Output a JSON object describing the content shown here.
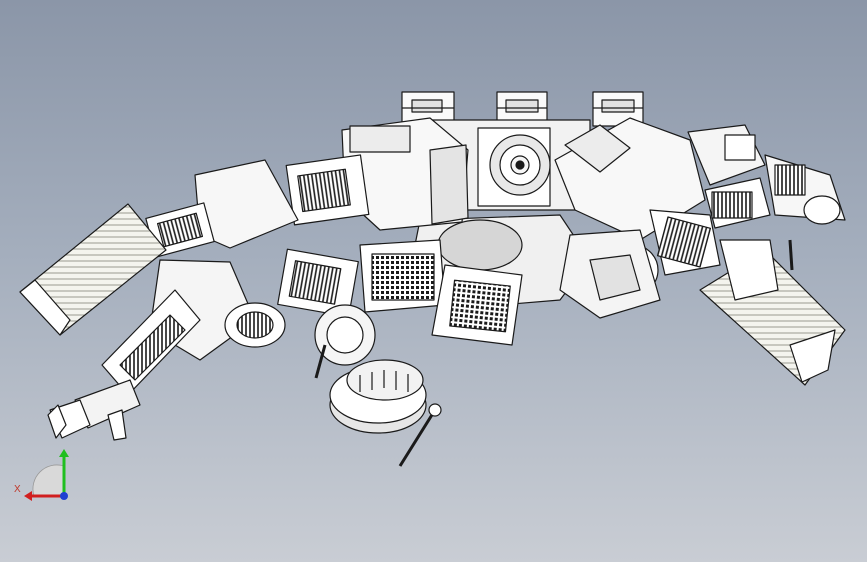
{
  "viewport": {
    "background_top": "#8b96a8",
    "background_bottom": "#c9cdd4"
  },
  "triad": {
    "x_label": "X",
    "x_color": "#d11f1f",
    "y_color": "#1fbf1f",
    "z_color": "#1f3fd1"
  },
  "model": {
    "icon": "multi-arm-robot-assembly-icon"
  }
}
